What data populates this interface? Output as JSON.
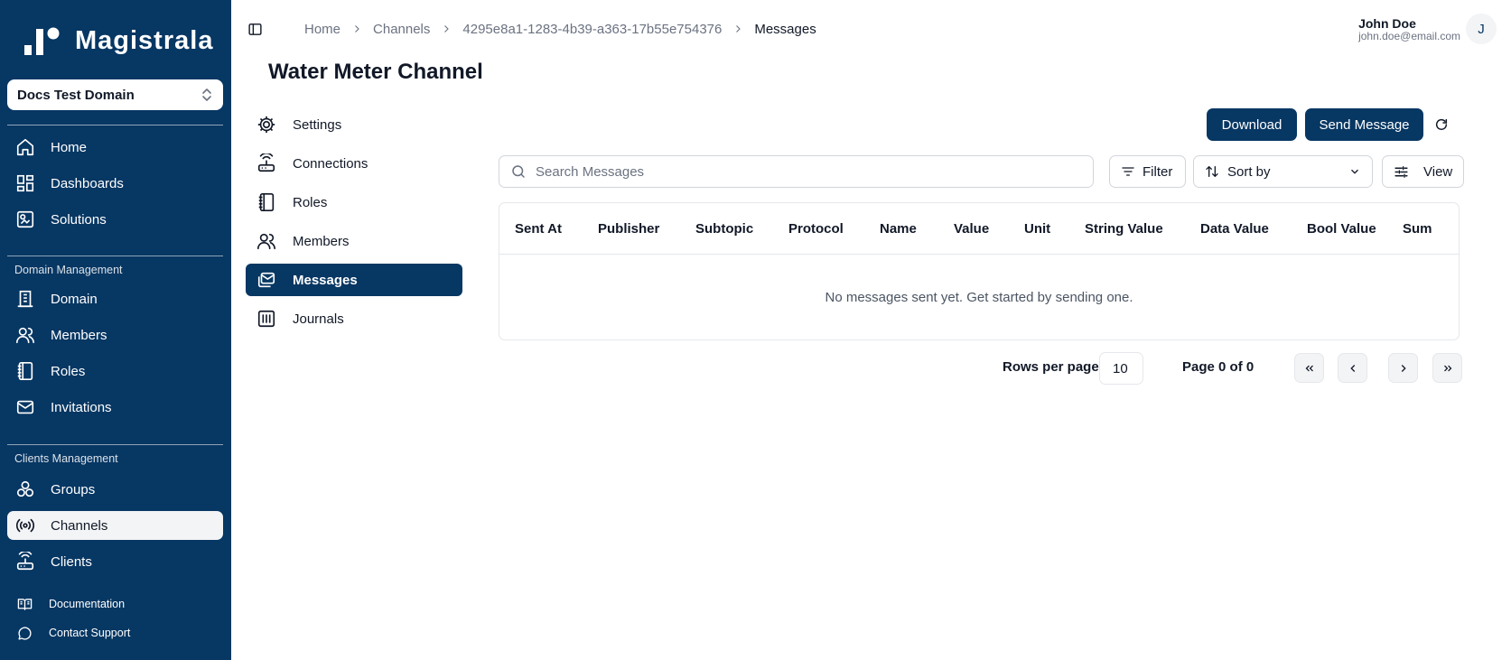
{
  "app": {
    "brand": "Magistrala"
  },
  "sidebar": {
    "domain": "Docs Test Domain",
    "main_items": [
      {
        "label": "Home",
        "icon": "home-icon"
      },
      {
        "label": "Dashboards",
        "icon": "dashboard-icon"
      },
      {
        "label": "Solutions",
        "icon": "solutions-icon"
      }
    ],
    "domain_management_label": "Domain Management",
    "domain_items": [
      {
        "label": "Domain",
        "icon": "building-icon"
      },
      {
        "label": "Members",
        "icon": "users-icon"
      },
      {
        "label": "Roles",
        "icon": "notebook-icon"
      },
      {
        "label": "Invitations",
        "icon": "mail-icon"
      }
    ],
    "clients_management_label": "Clients Management",
    "client_items": [
      {
        "label": "Groups",
        "icon": "groups-icon"
      },
      {
        "label": "Channels",
        "icon": "radio-icon",
        "active": true
      },
      {
        "label": "Clients",
        "icon": "router-icon"
      }
    ],
    "footer_items": [
      {
        "label": "Documentation",
        "icon": "book-icon"
      },
      {
        "label": "Contact Support",
        "icon": "chat-icon"
      }
    ]
  },
  "header": {
    "breadcrumb": [
      "Home",
      "Channels",
      "4295e8a1-1283-4b39-a363-17b55e754376",
      "Messages"
    ],
    "user_name": "John Doe",
    "user_email": "john.doe@email.com",
    "avatar_initial": "J"
  },
  "page": {
    "title": "Water Meter Channel"
  },
  "subnav": [
    {
      "label": "Settings",
      "icon": "settings-icon"
    },
    {
      "label": "Connections",
      "icon": "router-icon"
    },
    {
      "label": "Roles",
      "icon": "notebook-icon"
    },
    {
      "label": "Members",
      "icon": "users-icon"
    },
    {
      "label": "Messages",
      "icon": "messages-icon",
      "active": true
    },
    {
      "label": "Journals",
      "icon": "journal-icon"
    }
  ],
  "actions": {
    "download": "Download",
    "send_message": "Send Message"
  },
  "toolbar": {
    "search_placeholder": "Search Messages",
    "filter": "Filter",
    "sort_by": "Sort by",
    "view": "View"
  },
  "table": {
    "columns": [
      "Sent At",
      "Publisher",
      "Subtopic",
      "Protocol",
      "Name",
      "Value",
      "Unit",
      "String Value",
      "Data Value",
      "Bool Value",
      "Sum"
    ],
    "empty_message": "No messages sent yet. Get started by sending one."
  },
  "pagination": {
    "rows_per_page_label": "Rows per page",
    "rows_per_page": "10",
    "page_info": "Page 0 of 0"
  },
  "colors": {
    "primary": "#073763",
    "active_bg": "#f3f4f6",
    "border": "#e5e7eb"
  }
}
